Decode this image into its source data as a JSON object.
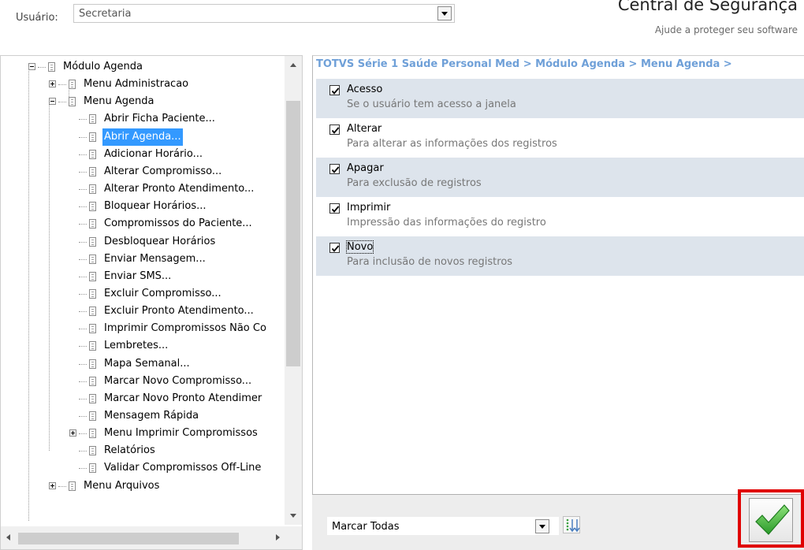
{
  "header": {
    "user_label": "Usuário:",
    "user_value": "Secretaria",
    "title": "Central de Segurança",
    "subtitle": "Ajude a proteger seu software"
  },
  "tree": {
    "items": [
      {
        "label": "Módulo Agenda",
        "level": 0,
        "expander": "minus",
        "selected": false
      },
      {
        "label": "Menu Administracao",
        "level": 1,
        "expander": "plus",
        "selected": false
      },
      {
        "label": "Menu Agenda",
        "level": 1,
        "expander": "minus",
        "selected": false
      },
      {
        "label": "Abrir  Ficha Paciente...",
        "level": 2,
        "expander": "",
        "selected": false
      },
      {
        "label": "Abrir Agenda...",
        "level": 2,
        "expander": "",
        "selected": true
      },
      {
        "label": "Adicionar Horário...",
        "level": 2,
        "expander": "",
        "selected": false
      },
      {
        "label": "Alterar Compromisso...",
        "level": 2,
        "expander": "",
        "selected": false
      },
      {
        "label": "Alterar Pronto Atendimento...",
        "level": 2,
        "expander": "",
        "selected": false
      },
      {
        "label": "Bloquear Horários...",
        "level": 2,
        "expander": "",
        "selected": false
      },
      {
        "label": "Compromissos do Paciente...",
        "level": 2,
        "expander": "",
        "selected": false
      },
      {
        "label": "Desbloquear Horários",
        "level": 2,
        "expander": "",
        "selected": false
      },
      {
        "label": "Enviar Mensagem...",
        "level": 2,
        "expander": "",
        "selected": false
      },
      {
        "label": "Enviar SMS...",
        "level": 2,
        "expander": "",
        "selected": false
      },
      {
        "label": "Excluir Compromisso...",
        "level": 2,
        "expander": "",
        "selected": false
      },
      {
        "label": "Excluir Pronto Atendimento...",
        "level": 2,
        "expander": "",
        "selected": false
      },
      {
        "label": "Imprimir Compromissos Não Co",
        "level": 2,
        "expander": "",
        "selected": false
      },
      {
        "label": "Lembretes...",
        "level": 2,
        "expander": "",
        "selected": false
      },
      {
        "label": "Mapa Semanal...",
        "level": 2,
        "expander": "",
        "selected": false
      },
      {
        "label": "Marcar Novo Compromisso...",
        "level": 2,
        "expander": "",
        "selected": false
      },
      {
        "label": "Marcar Novo Pronto Atendimer",
        "level": 2,
        "expander": "",
        "selected": false
      },
      {
        "label": "Mensagem Rápida",
        "level": 2,
        "expander": "",
        "selected": false
      },
      {
        "label": "Menu Imprimir Compromissos",
        "level": 2,
        "expander": "plus",
        "selected": false
      },
      {
        "label": "Relatórios",
        "level": 2,
        "expander": "",
        "selected": false
      },
      {
        "label": "Validar Compromissos Off-Line",
        "level": 2,
        "expander": "",
        "selected": false
      },
      {
        "label": "Menu Arquivos",
        "level": 1,
        "expander": "plus",
        "selected": false
      }
    ]
  },
  "right": {
    "breadcrumb": "TOTVS Série 1 Saúde Personal Med > Módulo Agenda > Menu Agenda >",
    "permissions": [
      {
        "title": "Acesso",
        "description": "Se o usuário tem acesso a janela",
        "checked": true
      },
      {
        "title": "Alterar",
        "description": "Para alterar as informações dos registros",
        "checked": true
      },
      {
        "title": "Apagar",
        "description": "Para exclusão de registros",
        "checked": true
      },
      {
        "title": "Imprimir",
        "description": "Impressão das informações do registro",
        "checked": true
      },
      {
        "title": "Novo",
        "description": "Para inclusão de novos registros",
        "checked": true
      }
    ],
    "mark_select_value": "Marcar Todas"
  },
  "colors": {
    "selection": "#3399ff",
    "breadcrumb": "#6fa0d8",
    "highlight_border": "#e00000",
    "confirm_check": "#3aaa35"
  },
  "icons": {
    "tree_node": "document-icon",
    "confirm": "checkmark-icon",
    "sort": "sort-down-icon"
  }
}
